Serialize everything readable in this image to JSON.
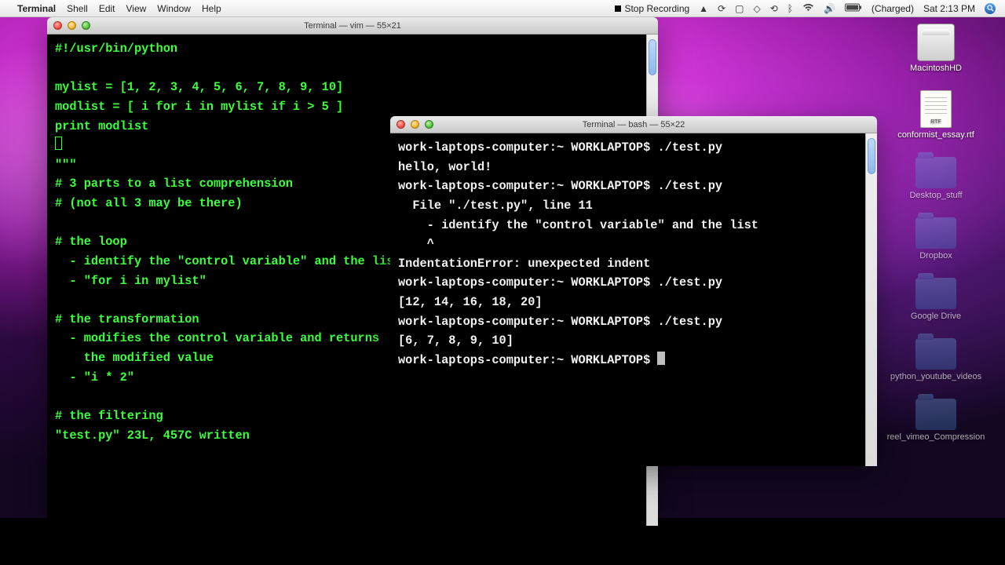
{
  "menubar": {
    "app_name": "Terminal",
    "items": [
      "Shell",
      "Edit",
      "View",
      "Window",
      "Help"
    ],
    "right": {
      "stop_recording": "Stop Recording",
      "battery": "(Charged)",
      "clock": "Sat 2:13 PM"
    }
  },
  "desk": {
    "hd_label": "MacintoshHD",
    "rtf_label": "conformist_essay.rtf",
    "folders": [
      "Desktop_stuff",
      "Dropbox",
      "Google Drive",
      "python_youtube_videos",
      "reel_vimeo_Compression"
    ]
  },
  "vim_window": {
    "title": "Terminal — vim — 55×21",
    "lines": [
      "#!/usr/bin/python",
      "",
      "mylist = [1, 2, 3, 4, 5, 6, 7, 8, 9, 10]",
      "modlist = [ i for i in mylist if i > 5 ]",
      "print modlist"
    ],
    "tripquote": "\"\"\"",
    "comment_block": [
      "# 3 parts to a list comprehension",
      "# (not all 3 may be there)",
      "",
      "# the loop",
      "  - identify the \"control variable\" and the list",
      "  - \"for i in mylist\"",
      "",
      "# the transformation",
      "  - modifies the control variable and returns",
      "    the modified value",
      "  - \"i * 2\"",
      "",
      "# the filtering"
    ],
    "status": "\"test.py\" 23L, 457C written"
  },
  "bash_window": {
    "title": "Terminal — bash — 55×22",
    "lines": [
      "work-laptops-computer:~ WORKLAPTOP$ ./test.py",
      "hello, world!",
      "work-laptops-computer:~ WORKLAPTOP$ ./test.py",
      "  File \"./test.py\", line 11",
      "    - identify the \"control variable\" and the list",
      "    ^",
      "IndentationError: unexpected indent",
      "work-laptops-computer:~ WORKLAPTOP$ ./test.py",
      "[12, 14, 16, 18, 20]",
      "work-laptops-computer:~ WORKLAPTOP$ ./test.py",
      "[6, 7, 8, 9, 10]",
      "work-laptops-computer:~ WORKLAPTOP$ "
    ]
  }
}
